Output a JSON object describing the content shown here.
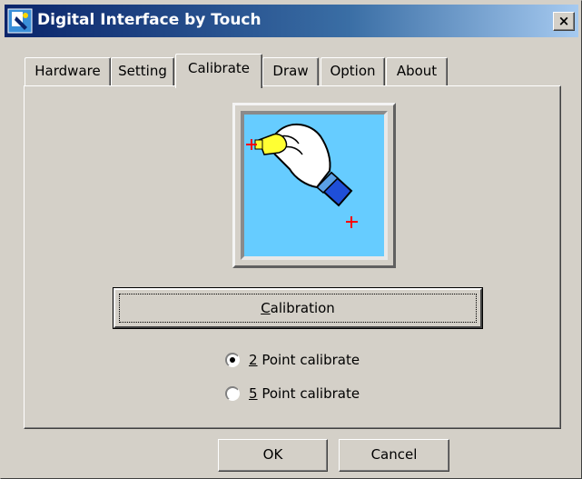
{
  "window": {
    "title": "Digital Interface by Touch",
    "close_glyph": "×"
  },
  "tabs": [
    {
      "label": "Hardware",
      "active": false
    },
    {
      "label": "Setting",
      "active": false
    },
    {
      "label": "Calibrate",
      "active": true
    },
    {
      "label": "Draw",
      "active": false
    },
    {
      "label": "Option",
      "active": false
    },
    {
      "label": "About",
      "active": false
    }
  ],
  "calibrate": {
    "illustration_icon": "hand-touch-calibration-icon",
    "calibration_button": {
      "mnemonic": "C",
      "rest": "alibration"
    },
    "options": [
      {
        "mnemonic": "2",
        "rest": " Point calibrate",
        "selected": true
      },
      {
        "mnemonic": "5",
        "rest": " Point calibrate",
        "selected": false
      }
    ]
  },
  "footer": {
    "ok_label": "OK",
    "cancel_label": "Cancel"
  },
  "colors": {
    "title_start": "#0a246a",
    "title_end": "#a6caf0",
    "face": "#d4d0c8",
    "screen": "#66ccff",
    "cross": "#ff0000"
  }
}
